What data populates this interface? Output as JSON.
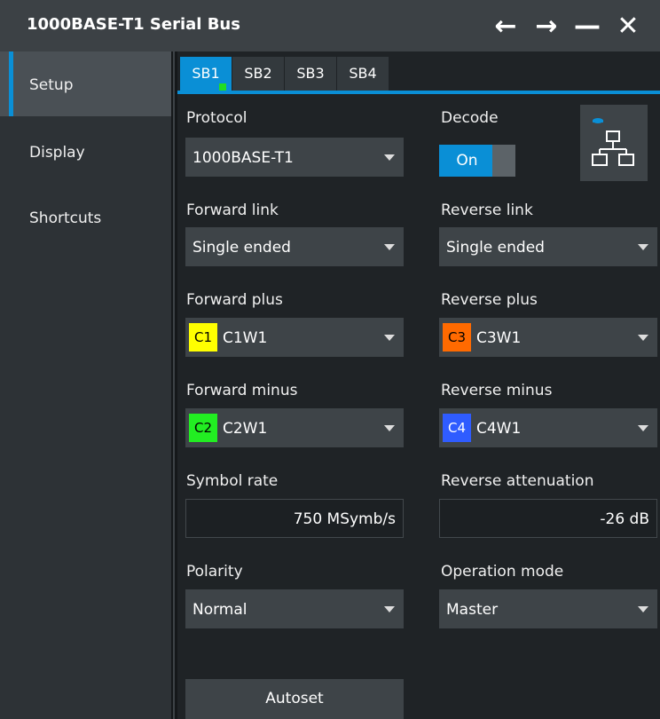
{
  "window": {
    "title": "1000BASE-T1 Serial Bus",
    "back_glyph": "←",
    "forward_glyph": "→",
    "minimize_glyph": "—",
    "close_glyph": "✕"
  },
  "sidebar": {
    "items": [
      {
        "label": "Setup",
        "active": true
      },
      {
        "label": "Display",
        "active": false
      },
      {
        "label": "Shortcuts",
        "active": false
      }
    ]
  },
  "tabs": [
    {
      "label": "SB1",
      "active": true
    },
    {
      "label": "SB2",
      "active": false
    },
    {
      "label": "SB3",
      "active": false
    },
    {
      "label": "SB4",
      "active": false
    }
  ],
  "form": {
    "protocol": {
      "label": "Protocol",
      "value": "1000BASE-T1"
    },
    "decode": {
      "label": "Decode",
      "value": "On"
    },
    "forward_link": {
      "label": "Forward link",
      "value": "Single ended"
    },
    "reverse_link": {
      "label": "Reverse link",
      "value": "Single ended"
    },
    "forward_plus": {
      "label": "Forward plus",
      "chip": "C1",
      "value": "C1W1",
      "chip_color": "#ffff00"
    },
    "reverse_plus": {
      "label": "Reverse plus",
      "chip": "C3",
      "value": "C3W1",
      "chip_color": "#ff6a00"
    },
    "forward_minus": {
      "label": "Forward minus",
      "chip": "C2",
      "value": "C2W1",
      "chip_color": "#22ee22"
    },
    "reverse_minus": {
      "label": "Reverse minus",
      "chip": "C4",
      "value": "C4W1",
      "chip_color": "#2f5cff"
    },
    "symbol_rate": {
      "label": "Symbol rate",
      "value": "750 MSymb/s"
    },
    "reverse_attenuation": {
      "label": "Reverse attenuation",
      "value": "-26 dB"
    },
    "polarity": {
      "label": "Polarity",
      "value": "Normal"
    },
    "operation_mode": {
      "label": "Operation mode",
      "value": "Master"
    },
    "autoset": {
      "label": "Autoset"
    }
  },
  "colors": {
    "accent": "#0a8fd6",
    "active_indicator": "#22dd22"
  },
  "icons": {
    "network_button": "network-topology-icon"
  }
}
